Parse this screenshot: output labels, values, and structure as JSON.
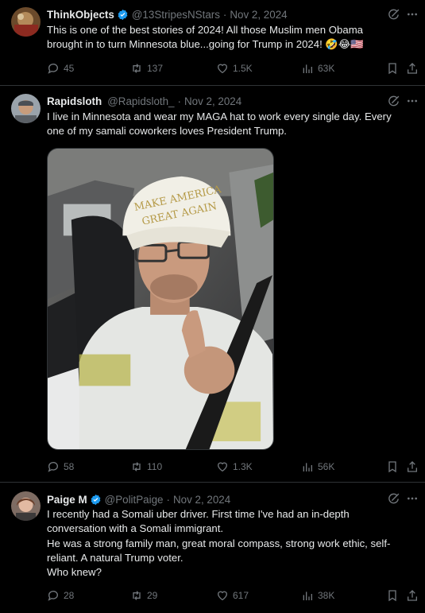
{
  "tweets": [
    {
      "name": "ThinkObjects",
      "handle": "@13StripesNStars",
      "date": "Nov 2, 2024",
      "lines": [
        "This is one of the best stories of 2024! All those Muslim men Obama",
        "brought in to turn Minnesota blue...going for Trump in 2024! 🤣😂🇺🇸"
      ],
      "replies": "45",
      "reposts": "137",
      "likes": "1.5K",
      "views": "63K"
    },
    {
      "name": "Rapidsloth",
      "handle": "@Rapidsloth_",
      "date": "Nov 2, 2024",
      "lines": [
        "I live in Minnesota and wear my MAGA hat to work every single day. Every",
        "one of my samali coworkers loves President Trump."
      ],
      "photo_hat_line1": "MAKE AMERICA",
      "photo_hat_line2": "GREAT AGAIN",
      "replies": "58",
      "reposts": "110",
      "likes": "1.3K",
      "views": "56K"
    },
    {
      "name": "Paige M",
      "handle": "@PolitPaige",
      "date": "Nov 2, 2024",
      "lines": [
        "I recently had a Somali uber driver. First time I've had an in-depth",
        "conversation with a Somali immigrant.",
        "He was a strong family man, great moral compass, strong work ethic, self-",
        "reliant. A natural Trump voter.",
        "Who knew?"
      ],
      "replies": "28",
      "reposts": "29",
      "likes": "617",
      "views": "38K"
    }
  ],
  "sep": "·",
  "colors": {
    "background": "#000000",
    "text": "#e7e9ea",
    "muted": "#71767b",
    "verified": "#1d9bf0",
    "divider": "#2f3336"
  }
}
